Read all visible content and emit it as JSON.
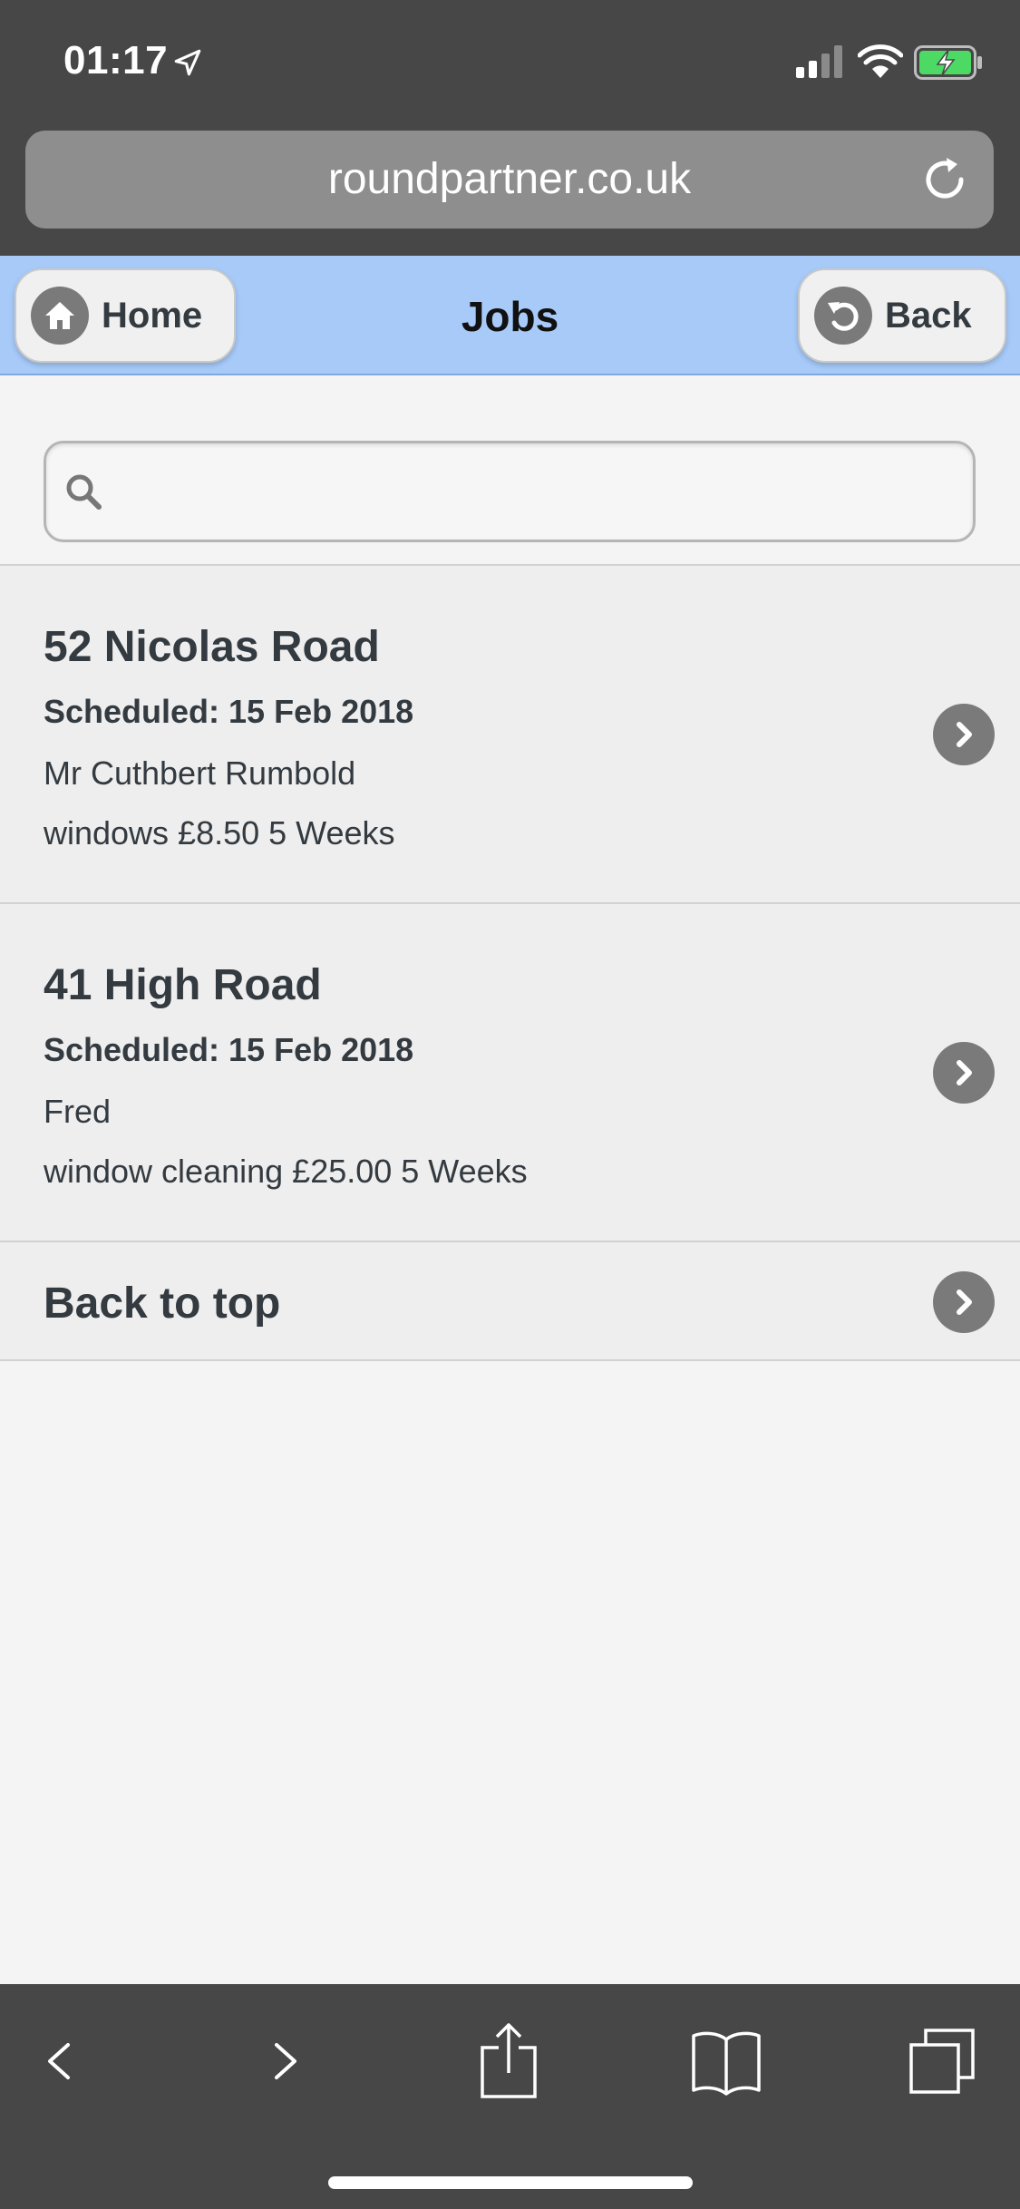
{
  "status_bar": {
    "time": "01:17"
  },
  "browser": {
    "url": "roundpartner.co.uk"
  },
  "header": {
    "title": "Jobs",
    "home_label": "Home",
    "back_label": "Back"
  },
  "search": {
    "placeholder": "",
    "value": ""
  },
  "jobs": [
    {
      "address": "52 Nicolas Road",
      "scheduled": "Scheduled: 15 Feb 2018",
      "customer": "Mr Cuthbert Rumbold",
      "detail": "windows £8.50 5 Weeks"
    },
    {
      "address": "41 High Road",
      "scheduled": "Scheduled: 15 Feb 2018",
      "customer": "Fred",
      "detail": "window cleaning £25.00 5 Weeks"
    }
  ],
  "back_to_top_label": "Back to top",
  "icons": {
    "location": "location-arrow-icon",
    "signal": "cellular-signal-icon",
    "wifi": "wifi-icon",
    "battery": "battery-charging-icon",
    "reload": "reload-icon",
    "home": "home-icon",
    "back": "back-arrow-icon",
    "search": "search-icon",
    "chevron": "chevron-right-icon",
    "share": "share-icon",
    "bookmarks": "bookmarks-icon",
    "tabs": "tabs-icon"
  },
  "colors": {
    "header_bg": "#a7caf9",
    "browser_chrome": "#474747",
    "battery_fill": "#4cd964"
  }
}
